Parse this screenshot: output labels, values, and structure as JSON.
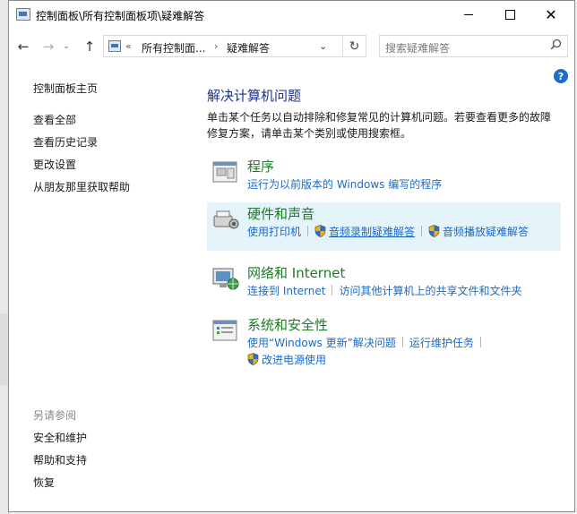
{
  "window": {
    "title": "控制面板\\所有控制面板项\\疑难解答",
    "controls": {
      "minimize": "—",
      "maximize": "☐",
      "close": "✕"
    }
  },
  "address": {
    "overflow": "«",
    "segment1": "所有控制面...",
    "chevron": "›",
    "segment2": "疑难解答",
    "dropdown": "⌄",
    "refresh": "↻",
    "search_placeholder": "搜索疑难解答",
    "search_icon": "search-icon"
  },
  "nav": {
    "back": "←",
    "forward": "→",
    "recent": "⌄",
    "up": "↑"
  },
  "help": {
    "label": "?",
    "color": "#1c6fc9"
  },
  "sidebar": {
    "items": [
      {
        "label": "控制面板主页"
      },
      {
        "label": "查看全部"
      },
      {
        "label": "查看历史记录"
      },
      {
        "label": "更改设置"
      },
      {
        "label": "从朋友那里获取帮助"
      }
    ],
    "see_also_heading": "另请参阅",
    "see_also": [
      {
        "label": "安全和维护"
      },
      {
        "label": "帮助和支持"
      },
      {
        "label": "恢复"
      }
    ]
  },
  "main": {
    "title": "解决计算机问题",
    "description": "单击某个任务以自动排除和修复常见的计算机问题。若要查看更多的故障修复方案，请单击某个类别或使用搜索框。",
    "categories": [
      {
        "title": "程序",
        "icon": "programs-icon",
        "links": [
          "运行为以前版本的 Windows 编写的程序"
        ]
      },
      {
        "title": "硬件和声音",
        "icon": "hardware-sound-icon",
        "links": [
          "使用打印机",
          "音频录制疑难解答",
          "音频播放疑难解答"
        ]
      },
      {
        "title": "网络和 Internet",
        "icon": "network-icon",
        "links": [
          "连接到 Internet",
          "访问其他计算机上的共享文件和文件夹"
        ]
      },
      {
        "title": "系统和安全性",
        "icon": "system-security-icon",
        "links": [
          "使用“Windows 更新”解决问题",
          "运行维护任务",
          "改进电源使用"
        ]
      }
    ]
  },
  "colors": {
    "title_blue": "#1e3287",
    "category_green": "#1f7a28",
    "link_blue": "#1b6ac9",
    "hover_bg": "#e5f3fb"
  }
}
